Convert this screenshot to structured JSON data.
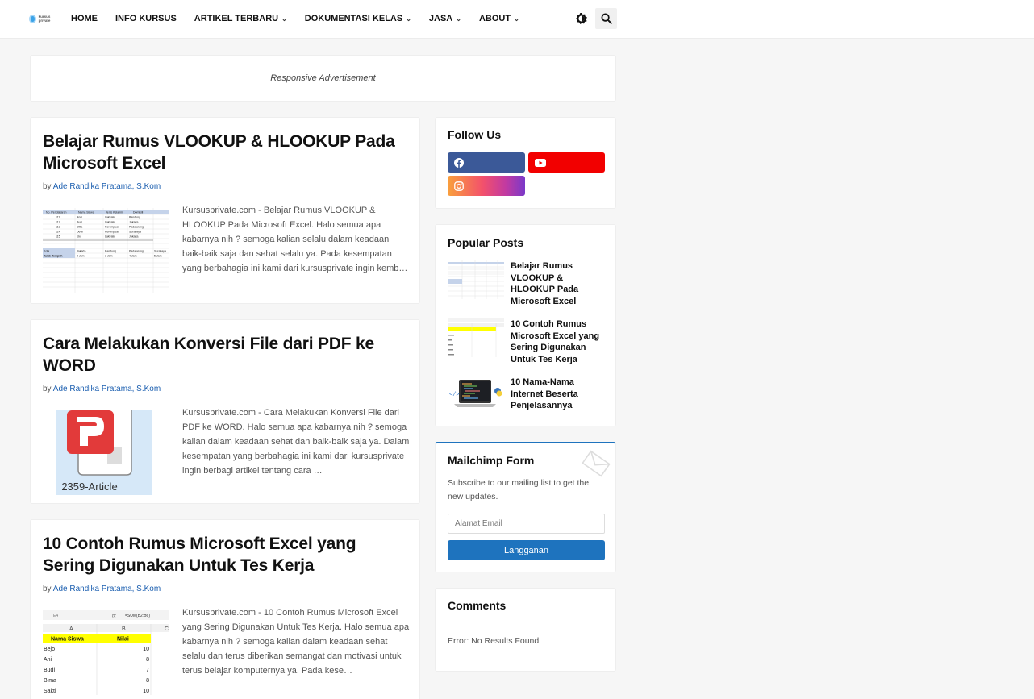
{
  "brand": {
    "logo_text": "kursus private",
    "icon": "site-logo"
  },
  "nav": {
    "items": [
      {
        "label": "HOME",
        "has_dropdown": false
      },
      {
        "label": "INFO KURSUS",
        "has_dropdown": false
      },
      {
        "label": "ARTIKEL TERBARU",
        "has_dropdown": true
      },
      {
        "label": "DOKUMENTASI KELAS",
        "has_dropdown": true
      },
      {
        "label": "JASA",
        "has_dropdown": true
      },
      {
        "label": "ABOUT",
        "has_dropdown": true
      }
    ],
    "theme_icon": "contrast-icon",
    "search_icon": "search-icon"
  },
  "ad": {
    "label": "Responsive Advertisement"
  },
  "posts": [
    {
      "title": "Belajar Rumus VLOOKUP & HLOOKUP Pada Microsoft Excel",
      "by": "by",
      "author": "Ade Randika Pratama, S.Kom",
      "excerpt": "Kursusprivate.com - Belajar Rumus VLOOKUP & HLOOKUP Pada Microsoft Excel. Halo semua apa kabarnya nih ? semoga kalian selalu dalam keadaan baik-baik saja dan sehat selalu ya. Pada kesempatan yang berbahagia ini kami dari kursusprivate ingin kemb…",
      "thumb": {
        "headers": [
          "No. Pendaftaran",
          "Nama Siswa",
          "Jenis Kelamin",
          "Domisili"
        ],
        "rows": [
          [
            "111",
            "Andi",
            "Laki-laki",
            "Bandung"
          ],
          [
            "112",
            "Budi",
            "Laki-laki",
            "Jakarta"
          ],
          [
            "113",
            "Ditta",
            "Perempuan",
            "Padalarang"
          ],
          [
            "114",
            "Dewi",
            "Perempuan",
            "Surabaya"
          ],
          [
            "115",
            "Eko",
            "Laki-laki",
            "Jakarta"
          ]
        ],
        "kota_label": "Kota",
        "kota": [
          "Jakarta",
          "Bandung",
          "Padalarang",
          "Surabaya"
        ],
        "jarak_label": "Jarak Tempuh",
        "jarak": [
          "2 Jam",
          "3 Jam",
          "4 Jam",
          "5 Jam"
        ]
      }
    },
    {
      "title": "Cara Melakukan Konversi File dari PDF ke WORD",
      "by": "by",
      "author": "Ade Randika Pratama, S.Kom",
      "excerpt": "Kursusprivate.com - Cara Melakukan Konversi File dari PDF ke WORD. Halo semua apa kabarnya nih ? semoga kalian dalam keadaan sehat dan baik-baik saja ya. Dalam kesempatan yang berbahagia ini kami dari kursusprivate ingin berbagi artikel tentang cara …",
      "thumb": {
        "caption": "2359-Article",
        "icon": "pdf-app-icon"
      }
    },
    {
      "title": "10 Contoh Rumus Microsoft Excel yang Sering Digunakan Untuk Tes Kerja",
      "by": "by",
      "author": "Ade Randika Pratama, S.Kom",
      "excerpt": "Kursusprivate.com - 10 Contoh Rumus Microsoft Excel yang Sering Digunakan Untuk Tes Kerja. Halo semua apa kabarnya nih ? semoga kalian dalam keadaan sehat selalu dan terus diberikan semangat dan motivasi untuk terus belajar komputernya ya.  Pada kese…",
      "thumb": {
        "cell": "E4",
        "fx": "fx",
        "formula": "=SUM(B2:B6)",
        "col_a": "A",
        "col_b": "B",
        "col_c": "C",
        "header": [
          "Nama Siswa",
          "Nilai"
        ],
        "rows": [
          [
            "Bejo",
            "10"
          ],
          [
            "Ani",
            "8"
          ],
          [
            "Budi",
            "7"
          ],
          [
            "Bima",
            "8"
          ],
          [
            "Sakti",
            "10"
          ]
        ]
      }
    }
  ],
  "sidebar": {
    "follow": {
      "title": "Follow Us",
      "icons": [
        "facebook-icon",
        "youtube-icon",
        "instagram-icon"
      ]
    },
    "popular": {
      "title": "Popular Posts",
      "items": [
        {
          "title": "Belajar Rumus VLOOKUP & HLOOKUP Pada Microsoft Excel"
        },
        {
          "title": "10 Contoh Rumus Microsoft Excel yang Sering Digunakan Untuk Tes Kerja"
        },
        {
          "title": "10 Nama-Nama Internet Beserta Penjelasannya"
        }
      ]
    },
    "mailchimp": {
      "title": "Mailchimp Form",
      "description": "Subscribe to our mailing list to get the new updates.",
      "placeholder": "Alamat Email",
      "button": "Langganan",
      "icon": "envelope-icon"
    },
    "comments": {
      "title": "Comments",
      "error": "Error: No Results Found"
    }
  },
  "colors": {
    "accent": "#1e73be",
    "link": "#1c5fb0",
    "facebook": "#3b5998",
    "youtube": "#f20000",
    "page_bg": "#f6f6f6"
  }
}
